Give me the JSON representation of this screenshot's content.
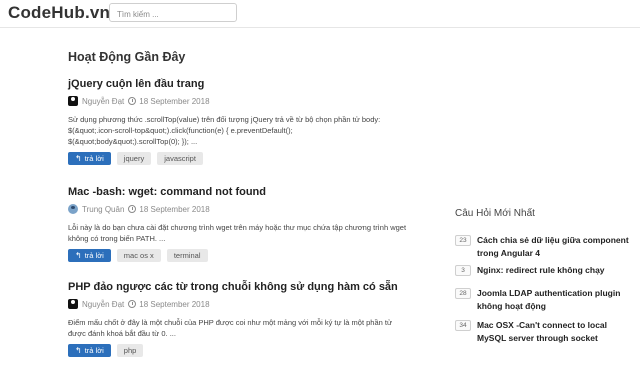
{
  "header": {
    "logo": "CodeHub.vn",
    "search_placeholder": "Tìm kiếm ..."
  },
  "main": {
    "section_title": "Hoạt Động Gần Đây",
    "reply_label": "trả lời",
    "posts": [
      {
        "title": "jQuery cuộn lên đầu trang",
        "author": "Nguyễn Đạt",
        "date": "18 September 2018",
        "excerpt_lines": [
          "Sử dụng phương thức .scrollTop(value) trên đối tượng jQuery trả về từ bộ chọn phần tử body:",
          "$(&quot;.icon-scroll-top&quot;).click(function(e) { e.preventDefault();",
          "$(&quot;body&quot;).scrollTop(0); }); ..."
        ],
        "tags": [
          "jquery",
          "javascript"
        ]
      },
      {
        "title": "Mac -bash: wget: command not found",
        "author": "Trung Quân",
        "date": "18 September 2018",
        "excerpt_lines": [
          "Lỗi này là do bạn chưa cài đặt chương trình wget trên máy hoặc thư mục chứa tập chương trình wget",
          "không có trong biến PATH. ..."
        ],
        "tags": [
          "mac os x",
          "terminal"
        ]
      },
      {
        "title": "PHP đảo ngược các từ trong chuỗi không sử dụng hàm có sẵn",
        "author": "Nguyễn Đạt",
        "date": "18 September 2018",
        "excerpt_lines": [
          "Điểm mấu chốt ở đây là một chuỗi của PHP được coi như một mảng với mỗi ký tự là một phần tử",
          "được đánh khoá bắt đầu từ 0. ..."
        ],
        "tags": [
          "php"
        ]
      }
    ]
  },
  "sidebar": {
    "title": "Câu Hỏi Mới Nhất",
    "items": [
      {
        "count": "23",
        "text_lines": [
          "Cách chia sẻ dữ liệu giữa component",
          "trong Angular 4"
        ]
      },
      {
        "count": "3",
        "text_lines": [
          "Nginx: redirect rule không chạy"
        ]
      },
      {
        "count": "28",
        "text_lines": [
          "Joomla LDAP authentication plugin",
          "không hoạt động"
        ]
      },
      {
        "count": "34",
        "text_lines": [
          "Mac OSX -Can't connect to local",
          "MySQL server through socket"
        ]
      }
    ]
  },
  "icons": {
    "reply": "reply-icon",
    "clock": "clock-icon"
  },
  "colors": {
    "reply_button": "#2c6fbb",
    "tag_bg": "#e8e8e8"
  }
}
